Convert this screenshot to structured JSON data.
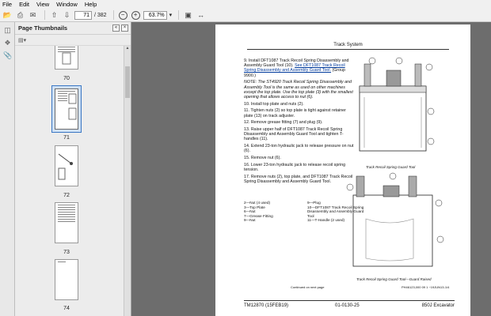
{
  "menu": [
    "File",
    "Edit",
    "View",
    "Window",
    "Help"
  ],
  "toolbar": {
    "page_current": "71",
    "page_total": "/ 382",
    "zoom": "63.7%"
  },
  "panel": {
    "title": "Page Thumbnails",
    "thumbnails": [
      {
        "num": "70"
      },
      {
        "num": "71"
      },
      {
        "num": "72"
      },
      {
        "num": "73"
      },
      {
        "num": "74"
      }
    ]
  },
  "doc": {
    "section_header": "Track System",
    "steps": [
      {
        "n": "9.",
        "text": "Install DFT1087 Track Recoil Spring Disassembly and Assembly Guard Tool (10).",
        "link": "See DFT1087 Track Recoil Spring Disassembly and Assembly Guard Tool.",
        "tail": "(Group 9900.)"
      },
      {
        "n": "NOTE:",
        "text": "The ST4920 Track Recoil Spring Disassembly and Assembly Tool is the same as used on other machines except the top plate. Use the top plate (3) with the smallest opening that allows access to nut (6)."
      },
      {
        "n": "10.",
        "text": "Install top plate and nuts (2)."
      },
      {
        "n": "11.",
        "text": "Tighten nuts (2) so top plate is tight against retainer plate (13) on track adjuster."
      },
      {
        "n": "12.",
        "text": "Remove grease fitting (7) and plug (9)."
      },
      {
        "n": "13.",
        "text": "Raise upper half of DFT1087 Track Recoil Spring Disassembly and Assembly Guard Tool and tighten T-handles (11)."
      },
      {
        "n": "14.",
        "text": "Extend 23-ton hydraulic jack to release pressure on nut (6)."
      },
      {
        "n": "15.",
        "text": "Remove nut (6)."
      },
      {
        "n": "16.",
        "text": "Lower 23-ton hydraulic jack to release recoil spring tension."
      },
      {
        "n": "17.",
        "text": "Remove nuts (2), top plate, and DFT1087 Track Recoil Spring Disassembly and Assembly Guard Tool."
      }
    ],
    "legend_left": [
      "2—Nut (4 used)",
      "3—Top Plate",
      "6—Nut",
      "7—Grease Fitting",
      "9—Nut"
    ],
    "legend_right": [
      "9—Plug",
      "10—DFT1087 Track Recoil Spring Disassembly and Assembly Guard Tool",
      "11—T-Handle (2 used)"
    ],
    "caption1": "Track Recoil Spring Guard Tool",
    "caption2": "Track Recoil Spring Guard Tool—Guard Raised",
    "continued": "Continued on next page",
    "refcode": "PH46123,000 09 1 −19JUN13-1/4",
    "footer_left": "TM12870 (15FEB19)",
    "footer_mid": "01-0130-25",
    "footer_right": "850J Excavator"
  },
  "colors": {
    "app_bg": "#6d6d6d",
    "link": "#003a9c",
    "selection": "#3b78c4"
  }
}
